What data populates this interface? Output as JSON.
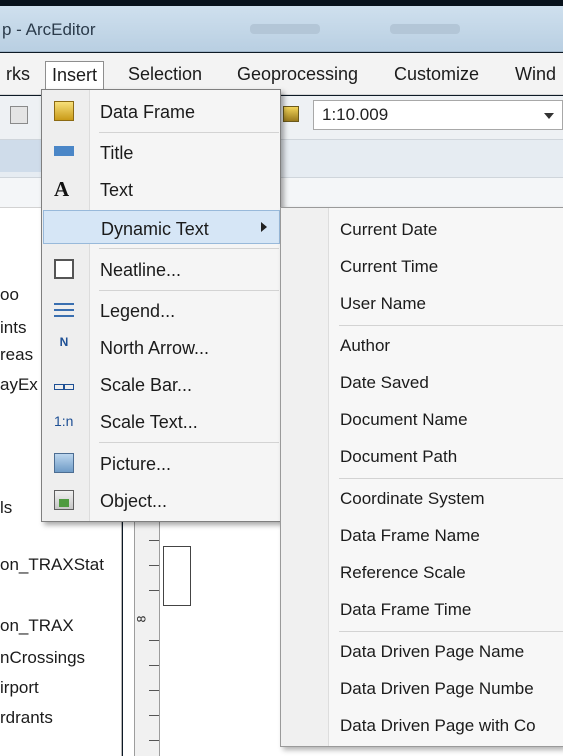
{
  "window": {
    "title": "p - ArcEditor"
  },
  "menubar": {
    "items": [
      {
        "label": "rks"
      },
      {
        "label": "Insert"
      },
      {
        "label": "Selection"
      },
      {
        "label": "Geoprocessing"
      },
      {
        "label": "Customize"
      },
      {
        "label": "Wind"
      }
    ]
  },
  "toolbar": {
    "scale_value": "1:10.009"
  },
  "toc": {
    "items": [
      {
        "label": "oo"
      },
      {
        "label": "ints"
      },
      {
        "label": "reas"
      },
      {
        "label": "ayEx"
      },
      {
        "label": "ls"
      },
      {
        "label": "on_TRAXStat"
      },
      {
        "label": "on_TRAX"
      },
      {
        "label": "nCrossings"
      },
      {
        "label": "irport"
      },
      {
        "label": "rdrants"
      }
    ]
  },
  "canvas": {
    "ruler_label": "8"
  },
  "insert_menu": {
    "items": [
      {
        "label": "Data Frame",
        "icon": "data-frame-icon"
      },
      {
        "label": "Title",
        "icon": "title-icon"
      },
      {
        "label": "Text",
        "icon": "text-icon"
      },
      {
        "label": "Dynamic Text",
        "icon": "",
        "has_submenu": true
      },
      {
        "label": "Neatline...",
        "icon": "neatline-icon"
      },
      {
        "label": "Legend...",
        "icon": "legend-icon"
      },
      {
        "label": "North Arrow...",
        "icon": "north-arrow-icon"
      },
      {
        "label": "Scale Bar...",
        "icon": "scale-bar-icon"
      },
      {
        "label": "Scale Text...",
        "icon": "scale-text-icon"
      },
      {
        "label": "Picture...",
        "icon": "picture-icon"
      },
      {
        "label": "Object...",
        "icon": "object-icon"
      }
    ],
    "icon_glyphs": {
      "text": "A",
      "north": "N",
      "scale_text": "1:n"
    }
  },
  "dynamic_text_menu": {
    "items": [
      {
        "label": "Current Date"
      },
      {
        "label": "Current Time"
      },
      {
        "label": "User Name"
      },
      {
        "label": "Author"
      },
      {
        "label": "Date Saved"
      },
      {
        "label": "Document Name"
      },
      {
        "label": "Document Path"
      },
      {
        "label": "Coordinate System"
      },
      {
        "label": "Data Frame Name"
      },
      {
        "label": "Reference Scale"
      },
      {
        "label": "Data Frame Time"
      },
      {
        "label": "Data Driven Page Name"
      },
      {
        "label": "Data Driven Page Numbe"
      },
      {
        "label": "Data Driven Page with Co"
      }
    ]
  },
  "colors": {
    "highlight": "#d6e6f6",
    "menu_bg": "#f5f5f5",
    "titlebar": "#c7d9e9"
  }
}
